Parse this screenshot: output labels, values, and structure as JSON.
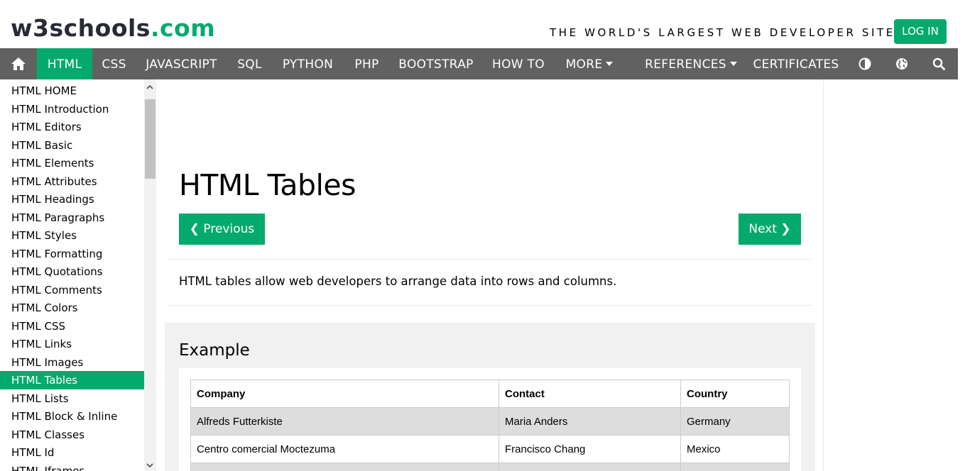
{
  "header": {
    "logo_main": "w3schools",
    "logo_suffix": ".com",
    "tagline": "THE WORLD'S LARGEST WEB DEVELOPER SITE",
    "login_label": "LOG IN"
  },
  "nav": {
    "home_icon": "home-icon",
    "items": [
      "HTML",
      "CSS",
      "JAVASCRIPT",
      "SQL",
      "PYTHON",
      "PHP",
      "BOOTSTRAP",
      "HOW TO",
      "MORE",
      "REFERENCES",
      "CERTIFICATES"
    ],
    "active": "HTML",
    "theme_icon": "contrast-icon",
    "globe_icon": "globe-icon",
    "search_icon": "search-icon"
  },
  "sidebar": {
    "items": [
      "HTML HOME",
      "HTML Introduction",
      "HTML Editors",
      "HTML Basic",
      "HTML Elements",
      "HTML Attributes",
      "HTML Headings",
      "HTML Paragraphs",
      "HTML Styles",
      "HTML Formatting",
      "HTML Quotations",
      "HTML Comments",
      "HTML Colors",
      "HTML CSS",
      "HTML Links",
      "HTML Images",
      "HTML Tables",
      "HTML Lists",
      "HTML Block & Inline",
      "HTML Classes",
      "HTML Id",
      "HTML Iframes"
    ],
    "active": "HTML Tables"
  },
  "main": {
    "title": "HTML Tables",
    "prev_label": "❮ Previous",
    "next_label": "Next ❯",
    "intro": "HTML tables allow web developers to arrange data into rows and columns.",
    "example_heading": "Example",
    "table": {
      "headers": [
        "Company",
        "Contact",
        "Country"
      ],
      "rows": [
        [
          "Alfreds Futterkiste",
          "Maria Anders",
          "Germany"
        ],
        [
          "Centro comercial Moctezuma",
          "Francisco Chang",
          "Mexico"
        ]
      ]
    }
  },
  "colors": {
    "accent": "#04aa6d",
    "nav_bg": "#616161"
  }
}
